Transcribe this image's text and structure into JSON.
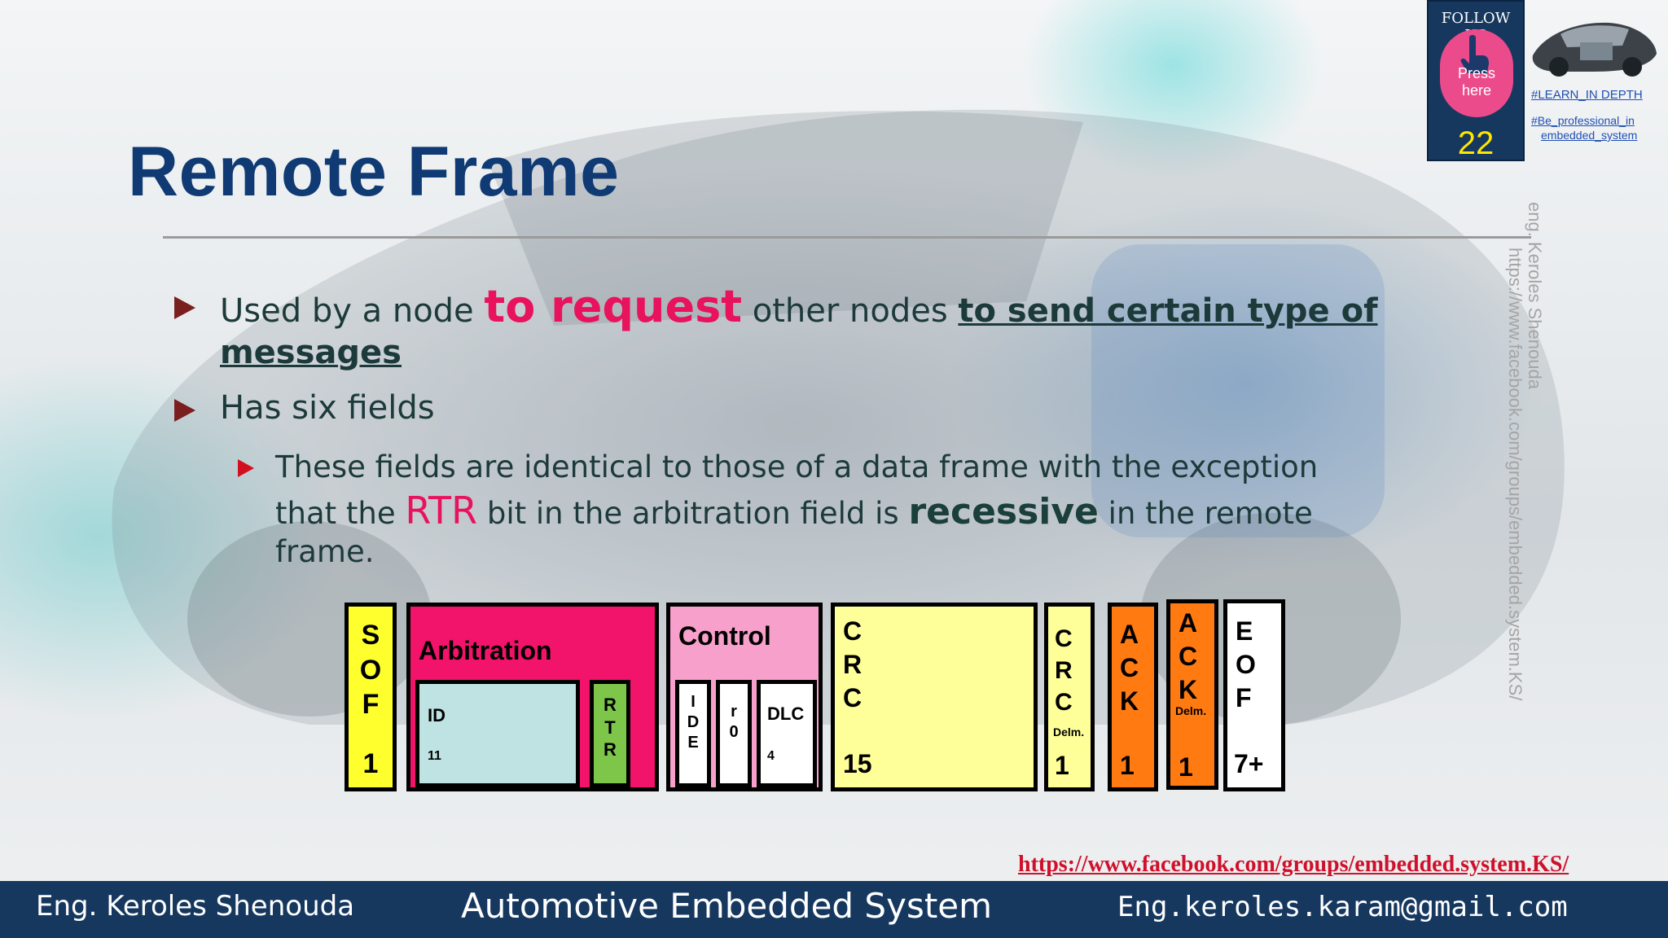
{
  "title": "Remote Frame",
  "bullets": {
    "b1": {
      "prefix": "Used by a node ",
      "pink": "to request",
      "mid": " other nodes ",
      "underlined_1": "to send certain type of",
      "underlined_2": "messages"
    },
    "b2": "Has six fields",
    "b3": {
      "line1": "These fields are identical to those of a data frame with the exception",
      "line2_pre": "that the ",
      "rtr": "RTR",
      "line2_mid": " bit in the arbitration field is ",
      "recessive": "recessive",
      "line2_post": " in the remote",
      "line3": "frame."
    }
  },
  "diagram": {
    "sof": {
      "letters": [
        "S",
        "O",
        "F"
      ],
      "size": "1",
      "color": "#ffff2e"
    },
    "arbitration": {
      "label": "Arbitration",
      "color": "#f2136a",
      "id_label": "ID",
      "id_size": "11",
      "id_color": "#bfe3e3",
      "rtr_letters": [
        "R",
        "T",
        "R"
      ],
      "rtr_color": "#7dc64a"
    },
    "control": {
      "label": "Control",
      "color": "#f7a0cc",
      "ide_letters": [
        "I",
        "D",
        "E"
      ],
      "r0_letters": [
        "r",
        "0"
      ],
      "dlc_label": "DLC",
      "dlc_size": "4"
    },
    "crc": {
      "letters": [
        "C",
        "R",
        "C"
      ],
      "size": "15",
      "color": "#ffff99"
    },
    "crc_delim": {
      "letters": [
        "C",
        "R",
        "C"
      ],
      "delim": "Delm.",
      "size": "1",
      "color": "#ffff99"
    },
    "ack": {
      "letters": [
        "A",
        "C",
        "K"
      ],
      "size": "1",
      "color": "#ff7a10"
    },
    "ack_delim": {
      "letters": [
        "A",
        "C",
        "K"
      ],
      "delim": "Delm.",
      "size": "1",
      "color": "#ff7a10"
    },
    "eof": {
      "letters": [
        "E",
        "O",
        "F"
      ],
      "size": "7+",
      "color": "#ffffff"
    }
  },
  "badge": {
    "follow": "FOLLOW US",
    "press": "Press",
    "here": "here",
    "page": "22",
    "tag1": "#LEARN_IN DEPTH",
    "tag2a": "#Be_professional_in",
    "tag2b": "embedded_system"
  },
  "watermark": {
    "name": "eng. Keroles Shenouda",
    "url": "https://www.facebook.com/groups/embedded.system.KS/"
  },
  "link": "https://www.facebook.com/groups/embedded.system.KS/",
  "footer": {
    "author": "Eng. Keroles Shenouda",
    "course": "Automotive Embedded System",
    "email": "Eng.keroles.karam@gmail.com"
  }
}
